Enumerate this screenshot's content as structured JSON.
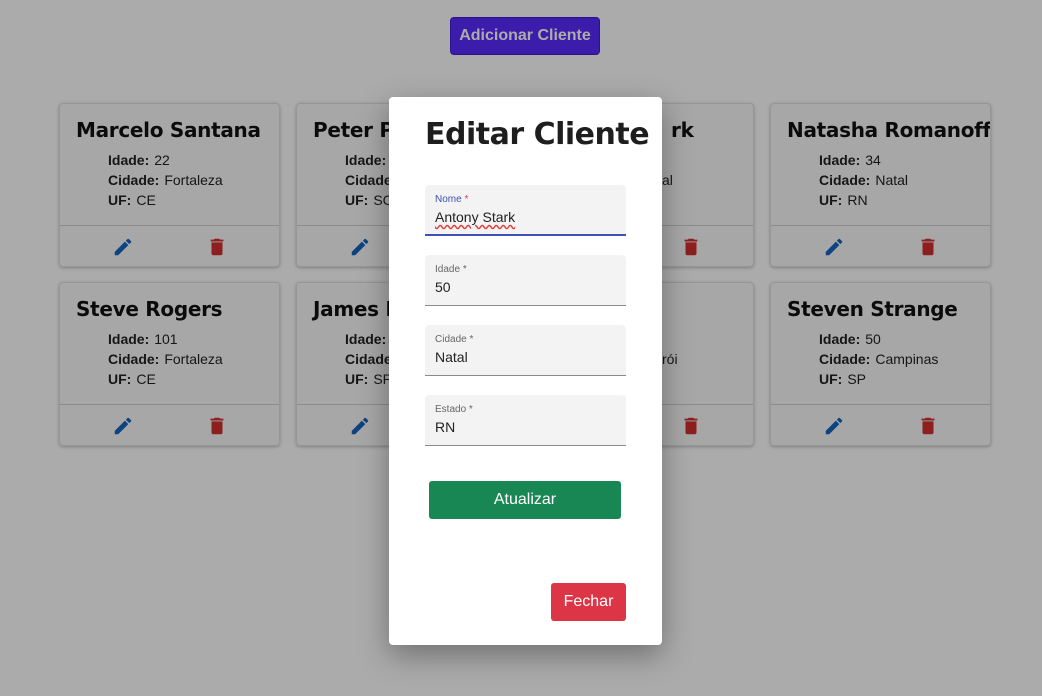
{
  "header": {
    "add_button_label": "Adicionar Cliente"
  },
  "labels": {
    "idade": "Idade:",
    "cidade": "Cidade:",
    "uf": "UF:"
  },
  "cards": [
    {
      "name": "Marcelo Santana",
      "idade": "22",
      "cidade": "Fortaleza",
      "uf": "CE"
    },
    {
      "name": "Peter Pa",
      "idade": "",
      "cidade": "",
      "uf": "SC"
    },
    {
      "name": "rk",
      "idade": "",
      "cidade": "al",
      "uf": ""
    },
    {
      "name": "Natasha Romanoff",
      "idade": "34",
      "cidade": "Natal",
      "uf": "RN"
    },
    {
      "name": "Steve Rogers",
      "idade": "101",
      "cidade": "Fortaleza",
      "uf": "CE"
    },
    {
      "name": "James I",
      "idade": "",
      "cidade": "",
      "uf": "SP"
    },
    {
      "name": "",
      "idade": "",
      "cidade": "rói",
      "uf": ""
    },
    {
      "name": "Steven Strange",
      "idade": "50",
      "cidade": "Campinas",
      "uf": "SP"
    }
  ],
  "icons": {
    "edit": "pencil-icon",
    "delete": "trash-icon"
  },
  "colors": {
    "edit": "#1565c0",
    "delete": "#d32f2f",
    "primary": "#5a2bff",
    "success": "#198754",
    "danger": "#dc3545"
  },
  "modal": {
    "title": "Editar Cliente",
    "fields": [
      {
        "label": "Nome",
        "value": "Antony Stark"
      },
      {
        "label": "Idade",
        "value": "50"
      },
      {
        "label": "Cidade",
        "value": "Natal"
      },
      {
        "label": "Estado",
        "value": "RN"
      }
    ],
    "update_label": "Atualizar",
    "close_label": "Fechar"
  }
}
